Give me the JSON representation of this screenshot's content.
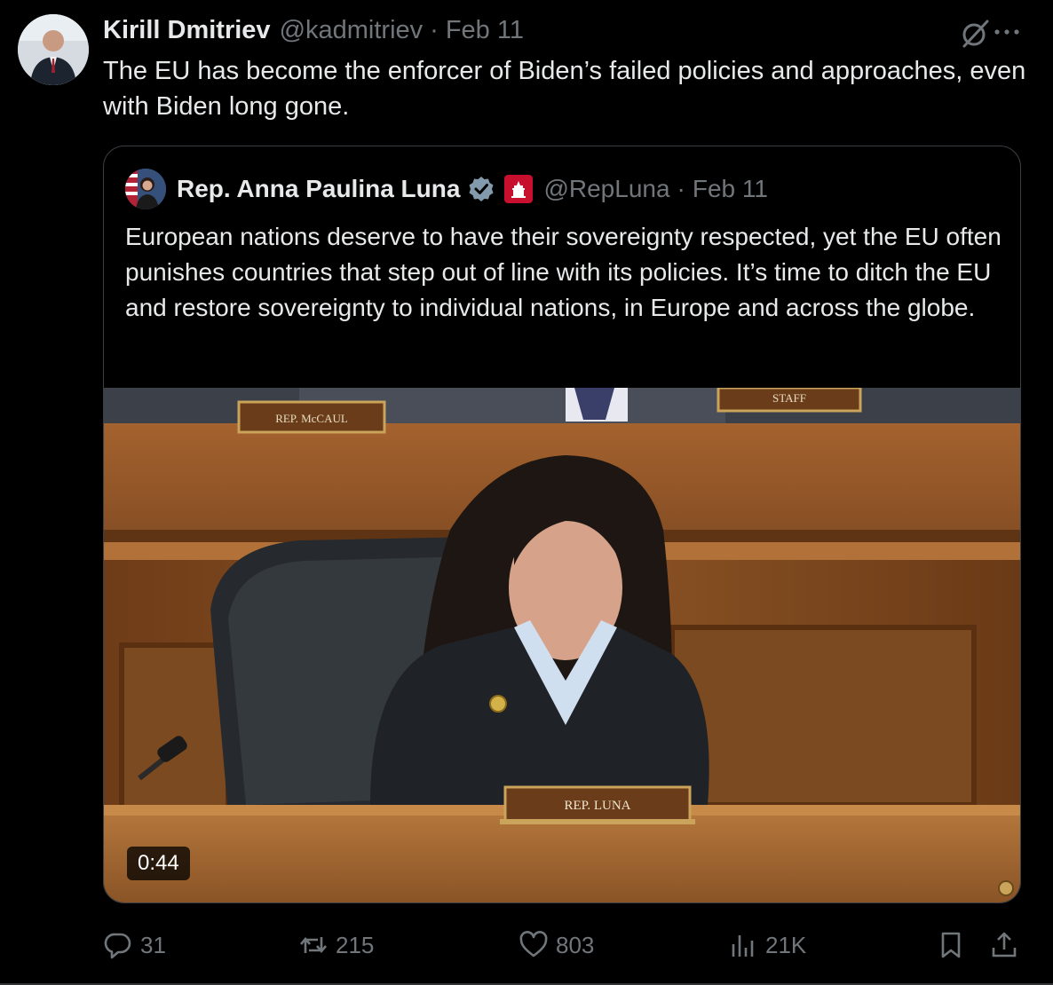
{
  "tweet": {
    "author_name": "Kirill Dmitriev",
    "author_handle": "@kadmitriev",
    "separator": "·",
    "date": "Feb 11",
    "text": "The EU has become the enforcer of Biden’s failed policies and approaches, even with Biden long gone."
  },
  "quote": {
    "author_name": "Rep. Anna Paulina Luna",
    "author_handle": "@RepLuna",
    "separator": "·",
    "date": "Feb 11",
    "text": "European nations deserve to have their sovereignty respected, yet the EU often punishes countries that step out of line with its policies. It’s time to ditch the EU and restore sovereignty to individual nations, in Europe and across the globe.",
    "video": {
      "duration": "0:44",
      "placard_luna": "REP. LUNA",
      "placard_mccaul": "REP. McCAUL",
      "placard_staff": "STAFF"
    }
  },
  "actions": {
    "replies": "31",
    "reposts": "215",
    "likes": "803",
    "views": "21K"
  },
  "colors": {
    "background": "#000000",
    "text": "#e7e9ea",
    "muted": "#71767b",
    "border": "#3a3f44",
    "verified": "#829aab"
  },
  "icons": [
    "grok-icon",
    "more-icon",
    "verified-icon",
    "flag-icon",
    "reply-icon",
    "repost-icon",
    "like-icon",
    "views-icon",
    "bookmark-icon",
    "share-icon"
  ]
}
